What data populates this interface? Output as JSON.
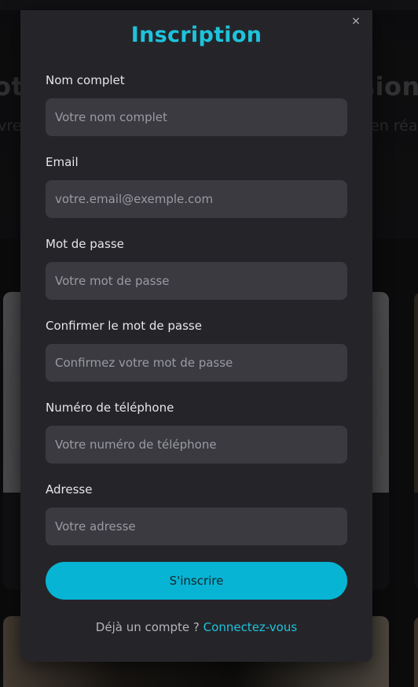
{
  "background": {
    "title_left": "otr",
    "title_right": "sion",
    "subtitle_left": "ivre",
    "subtitle_right": "en réa"
  },
  "modal": {
    "title": "Inscription",
    "close_label": "×",
    "fields": [
      {
        "label": "Nom complet",
        "placeholder": "Votre nom complet",
        "value": ""
      },
      {
        "label": "Email",
        "placeholder": "votre.email@exemple.com",
        "value": ""
      },
      {
        "label": "Mot de passe",
        "placeholder": "Votre mot de passe",
        "value": ""
      },
      {
        "label": "Confirmer le mot de passe",
        "placeholder": "Confirmez votre mot de passe",
        "value": ""
      },
      {
        "label": "Numéro de téléphone",
        "placeholder": "Votre numéro de téléphone",
        "value": ""
      },
      {
        "label": "Adresse",
        "placeholder": "Votre adresse",
        "value": ""
      }
    ],
    "submit_label": "S'inscrire",
    "footer_text": "Déjà un compte ?",
    "footer_link": "Connectez-vous"
  },
  "colors": {
    "accent": "#1ec3dc",
    "button": "#07b4d3",
    "modal_bg": "#252529",
    "input_bg": "#3a3a40"
  },
  "icons": {
    "close": "close-icon"
  }
}
